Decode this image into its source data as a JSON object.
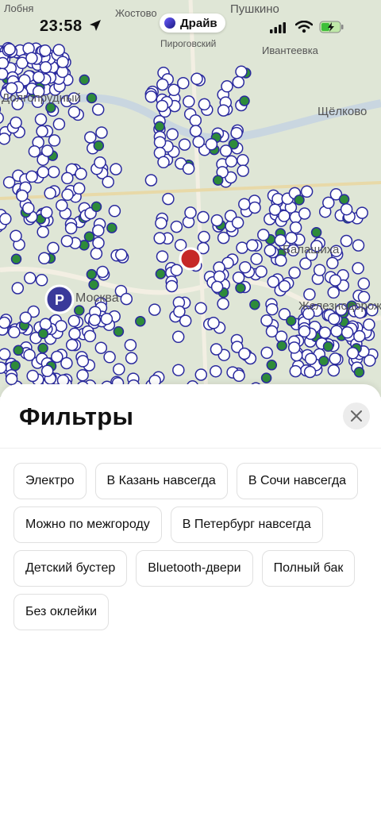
{
  "status_bar": {
    "time": "23:58",
    "location_icon": "location-arrow-icon",
    "app_badge": "Драйв",
    "signal_icon": "cellular-signal-icon",
    "wifi_icon": "wifi-icon",
    "battery_icon": "battery-charging-icon"
  },
  "map": {
    "places": [
      "Лобня",
      "Жостово",
      "Пушкино",
      "Пироговский",
      "Ивантеевка",
      "Долгопрудный",
      "Щёлково",
      "Балашиха",
      "Москва",
      "Железнодорожный"
    ],
    "parking_label": "P",
    "colors": {
      "car_marker": "#2a2a9e",
      "electro_marker": "#2e8b3a",
      "user_marker": "#c62828"
    }
  },
  "filters_sheet": {
    "title": "Фильтры",
    "close_icon": "close-icon",
    "chips": [
      "Электро",
      "В Казань навсегда",
      "В Сочи навсегда",
      "Можно по межгороду",
      "В Петербург навсегда",
      "Детский бустер",
      "Bluetooth-двери",
      "Полный бак",
      "Без оклейки"
    ]
  }
}
